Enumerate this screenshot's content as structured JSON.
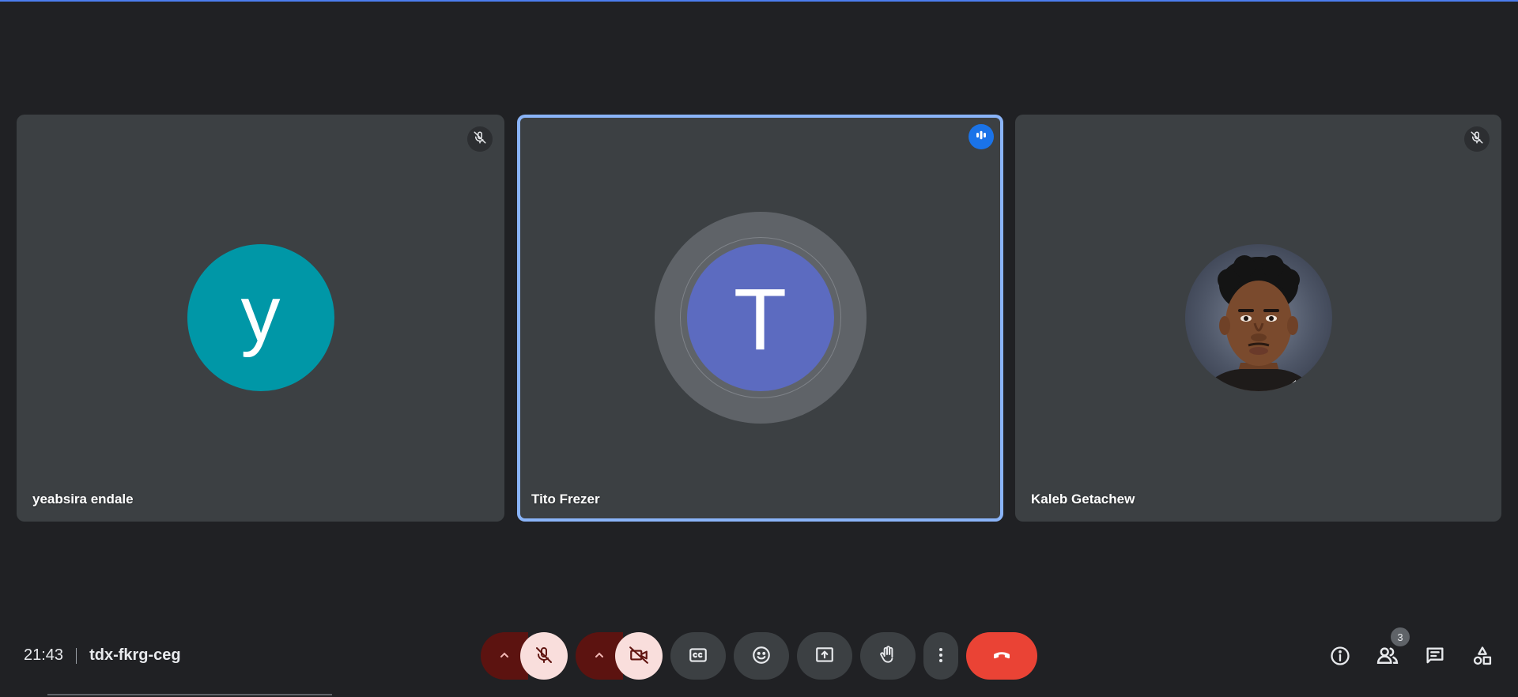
{
  "meeting": {
    "time": "21:43",
    "code": "tdx-fkrg-ceg"
  },
  "participants": [
    {
      "name": "yeabsira endale",
      "initial": "y",
      "avatar_color": "#0097a7",
      "status": "muted"
    },
    {
      "name": "Tito Frezer",
      "initial": "T",
      "avatar_color": "#5c6bc0",
      "status": "speaking"
    },
    {
      "name": "Kaleb Getachew",
      "initial": "",
      "avatar_type": "photo",
      "status": "muted"
    }
  ],
  "people": {
    "count": "3"
  },
  "colors": {
    "speaking_border": "#8ab4f8",
    "hangup": "#ea4335",
    "mic_off_bg": "#f9dedc",
    "caret_bg": "#5c1310",
    "talking_indicator": "#1a73e8"
  },
  "icons": {
    "mic_caret": "chevron-up-icon",
    "mic": "mic-off-icon",
    "cam_caret": "chevron-up-icon",
    "cam": "videocam-off-icon",
    "captions": "closed-caption-icon",
    "reactions": "emoji-icon",
    "present": "present-screen-icon",
    "hand": "raise-hand-icon",
    "more": "more-vert-icon",
    "leave": "call-end-icon",
    "info": "info-icon",
    "people": "people-icon",
    "chat": "chat-icon",
    "activities": "activities-icon"
  }
}
